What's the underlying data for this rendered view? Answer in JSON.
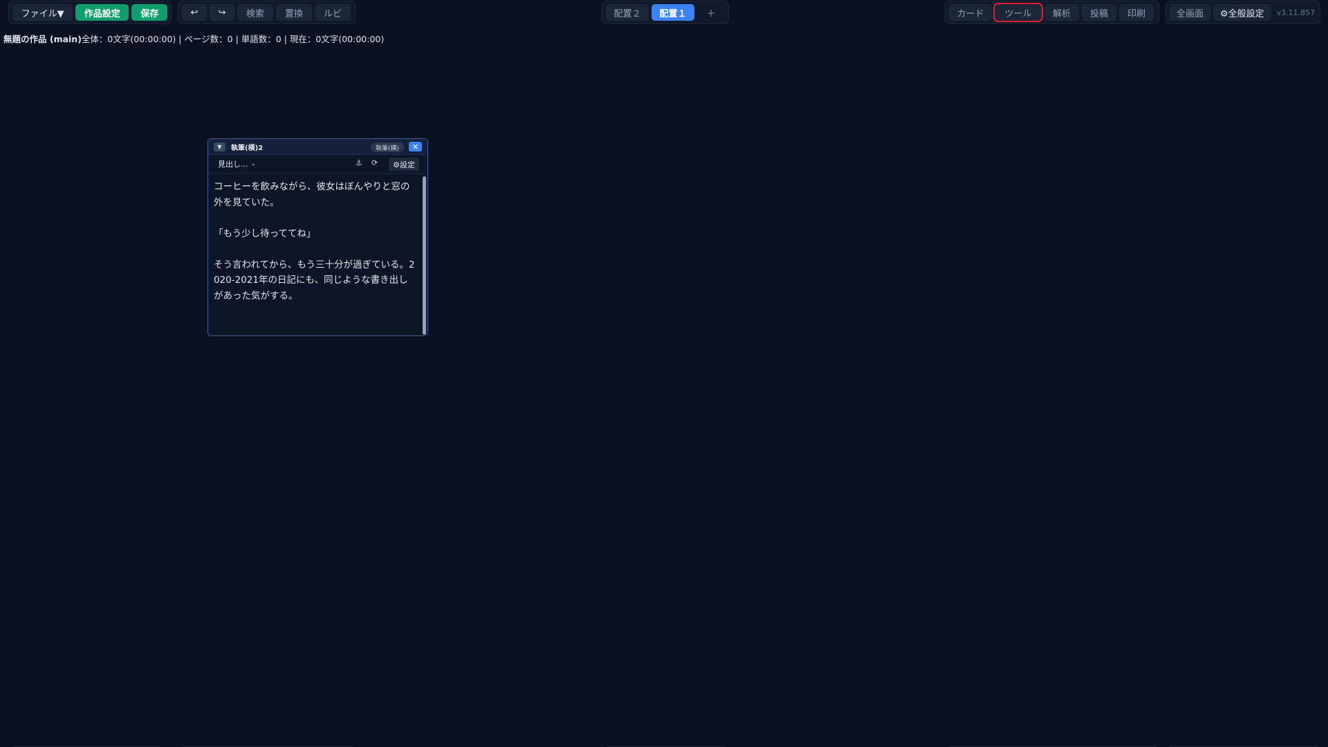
{
  "toolbar": {
    "file_menu": "ファイル▼",
    "work_settings": "作品設定",
    "save": "保存",
    "undo_icon": "↩",
    "redo_icon": "↪",
    "search": "検索",
    "replace": "置換",
    "ruby": "ルビ"
  },
  "layout_tabs": {
    "tab2": "配置２",
    "tab1": "配置１",
    "add": "＋"
  },
  "right_nav": {
    "card": "カード",
    "tool": "ツール",
    "analysis": "解析",
    "post": "投稿",
    "print": "印刷"
  },
  "settings_group": {
    "fullscreen": "全画面",
    "general_settings": "⚙全般設定",
    "version": "v3.11.857"
  },
  "status": {
    "title": "無題の作品 (main)",
    "stats": "全体：0文字(00:00:00) | ページ数：0 | 単語数：0 | 現在：0文字(00:00:00)"
  },
  "panel": {
    "collapse_icon": "▼",
    "title": "執筆(横)2",
    "mode_badge": "執筆(横)",
    "close_icon": "✕",
    "heading_select": "見出し...",
    "heading_chevron": "⌄",
    "anchor_icon": "⚓",
    "refresh_icon": "⟳",
    "settings": "⚙設定",
    "content": "コーヒーを飲みながら、彼女はぼんやりと窓の外を見ていた。\n\n「もう少し待っててね」\n\nそう言われてから、もう三十分が過ぎている。2020-2021年の日記にも、同じような書き出しがあった気がする。"
  },
  "colors": {
    "background": "#0b1120",
    "accent_blue": "#3b82f6",
    "accent_green": "#0f9f6e",
    "highlight_red": "#e11d2c"
  }
}
